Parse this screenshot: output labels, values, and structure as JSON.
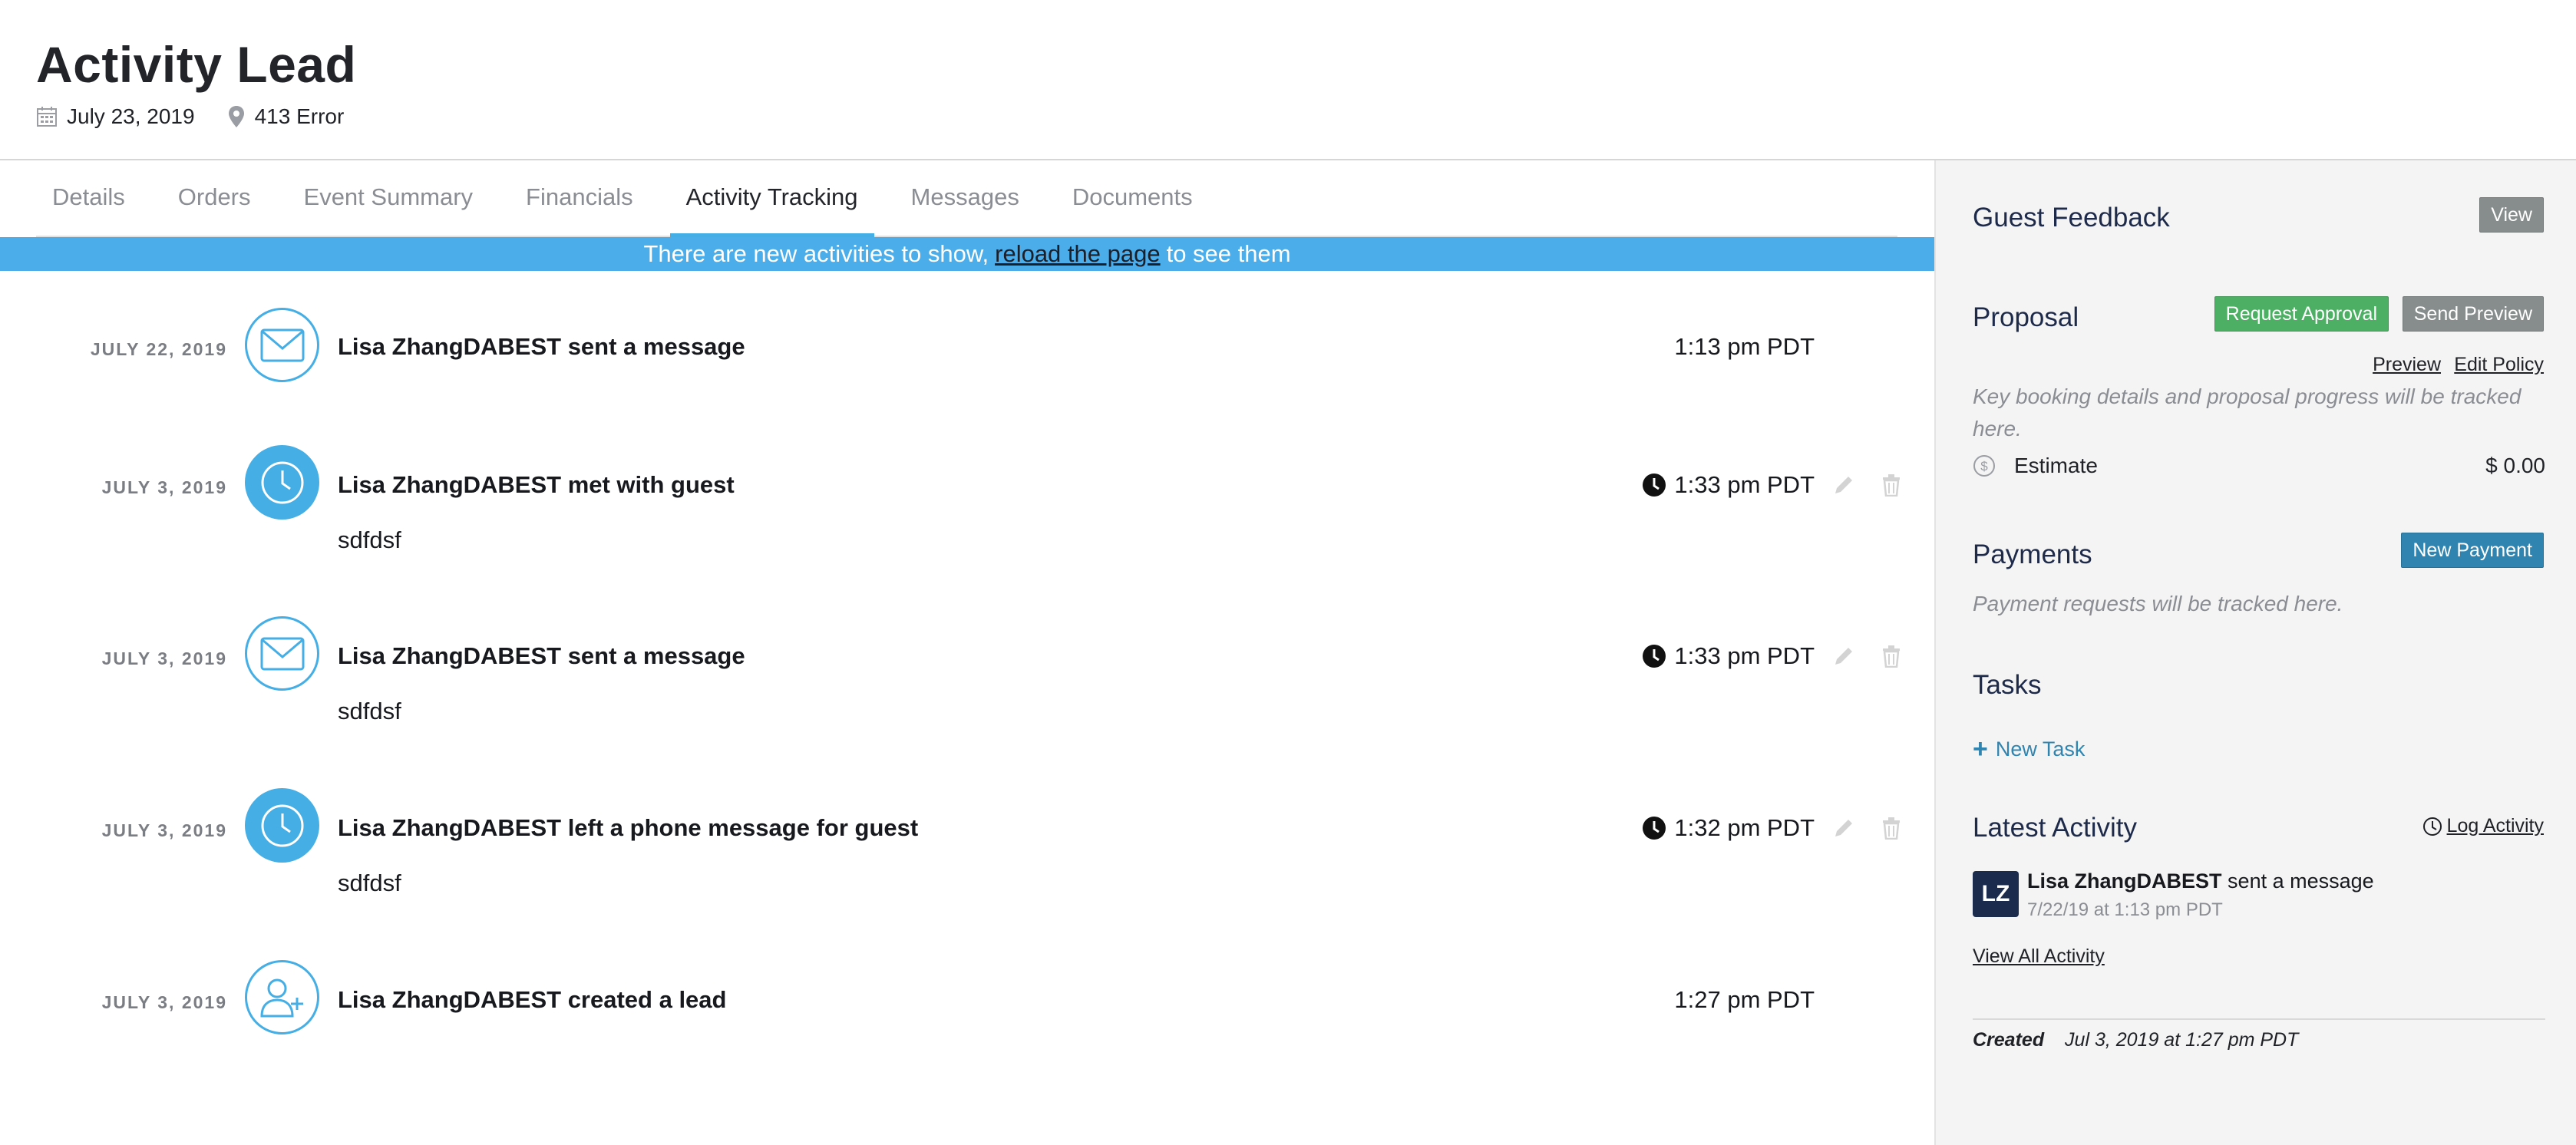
{
  "header": {
    "title": "Activity Lead",
    "date": "July 23, 2019",
    "location": "413 Error"
  },
  "tabs": [
    {
      "label": "Details",
      "active": false
    },
    {
      "label": "Orders",
      "active": false
    },
    {
      "label": "Event Summary",
      "active": false
    },
    {
      "label": "Financials",
      "active": false
    },
    {
      "label": "Activity Tracking",
      "active": true
    },
    {
      "label": "Messages",
      "active": false
    },
    {
      "label": "Documents",
      "active": false
    }
  ],
  "notice": {
    "prefix": "There are new activities to show,",
    "link": "reload the page",
    "suffix": "to see them"
  },
  "activities": [
    {
      "date": "JULY 22, 2019",
      "icon": "envelope-icon",
      "title": "Lisa ZhangDABEST sent a message",
      "body": "",
      "time": "1:13 pm PDT"
    },
    {
      "date": "JULY 3, 2019",
      "icon": "clock-icon",
      "title": "Lisa ZhangDABEST met with guest",
      "body": "sdfdsf",
      "time": "1:33 pm PDT"
    },
    {
      "date": "JULY 3, 2019",
      "icon": "envelope-icon",
      "title": "Lisa ZhangDABEST sent a message",
      "body": "sdfdsf",
      "time": "1:33 pm PDT"
    },
    {
      "date": "JULY 3, 2019",
      "icon": "clock-icon",
      "title": "Lisa ZhangDABEST left a phone message for guest",
      "body": "sdfdsf",
      "time": "1:32 pm PDT"
    },
    {
      "date": "JULY 3, 2019",
      "icon": "add-user-icon",
      "title": "Lisa ZhangDABEST created a lead",
      "body": "",
      "time": "1:27 pm PDT"
    }
  ],
  "sidebar": {
    "guest_feedback": {
      "heading": "Guest Feedback",
      "view_label": "View"
    },
    "proposal": {
      "heading": "Proposal",
      "request_approval_label": "Request Approval",
      "send_preview_label": "Send Preview",
      "preview_link": "Preview",
      "edit_policy_link": "Edit Policy",
      "note": "Key booking details and proposal progress will be tracked here.",
      "estimate_label": "Estimate",
      "estimate_value": "$ 0.00"
    },
    "payments": {
      "heading": "Payments",
      "new_payment_label": "New Payment",
      "note": "Payment requests will be tracked here."
    },
    "tasks": {
      "heading": "Tasks",
      "new_task_label": "New Task"
    },
    "latest_activity": {
      "heading": "Latest Activity",
      "log_activity_label": "Log Activity",
      "avatar_initials": "LZ",
      "user": "Lisa ZhangDABEST",
      "action": "sent a message",
      "timestamp": "7/22/19 at 1:13 pm PDT",
      "view_all_label": "View All Activity"
    },
    "created": {
      "label": "Created",
      "value": "Jul 3, 2019 at 1:27 pm PDT"
    }
  },
  "colors": {
    "accent": "#45aee5",
    "notice_bar": "#4badea",
    "button_green": "#4caf63",
    "button_gray": "#878c8c",
    "button_blue": "#2f84b0",
    "sidebar_bg": "#f4f4f4",
    "avatar_bg": "#1b2b4e"
  }
}
